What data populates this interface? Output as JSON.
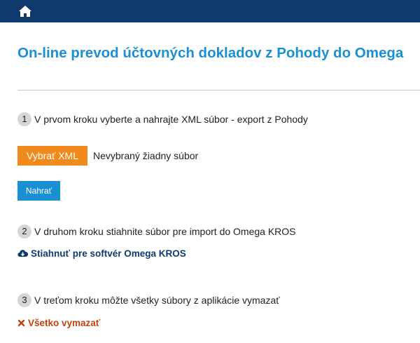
{
  "page": {
    "title": "On-line prevod účtovných dokladov z Pohody do Omega"
  },
  "colors": {
    "topbar": "#0e3a6e",
    "title": "#1a8fd3",
    "choose_button": "#f08a1c",
    "upload_button": "#1a8fd3",
    "download_link": "#0e3a6e",
    "delete_link": "#c2410c"
  },
  "topbar": {
    "home_icon": "home-icon"
  },
  "steps": [
    {
      "number": "1",
      "text": "V prvom kroku vyberte a nahrajte XML súbor - export z Pohody"
    },
    {
      "number": "2",
      "text": "V druhom kroku stiahnite súbor pre import do Omega KROS"
    },
    {
      "number": "3",
      "text": "V treťom kroku môžte všetky súbory z aplikácie vymazať"
    }
  ],
  "upload": {
    "choose_label": "Vybrať XML",
    "file_status": "Nevybraný žiadny súbor",
    "upload_label": "Nahrať"
  },
  "download": {
    "icon": "cloud-download-icon",
    "label": "Stiahnuť pre softvér Omega KROS"
  },
  "delete": {
    "icon": "close-icon",
    "label": "Všetko vymazať"
  }
}
